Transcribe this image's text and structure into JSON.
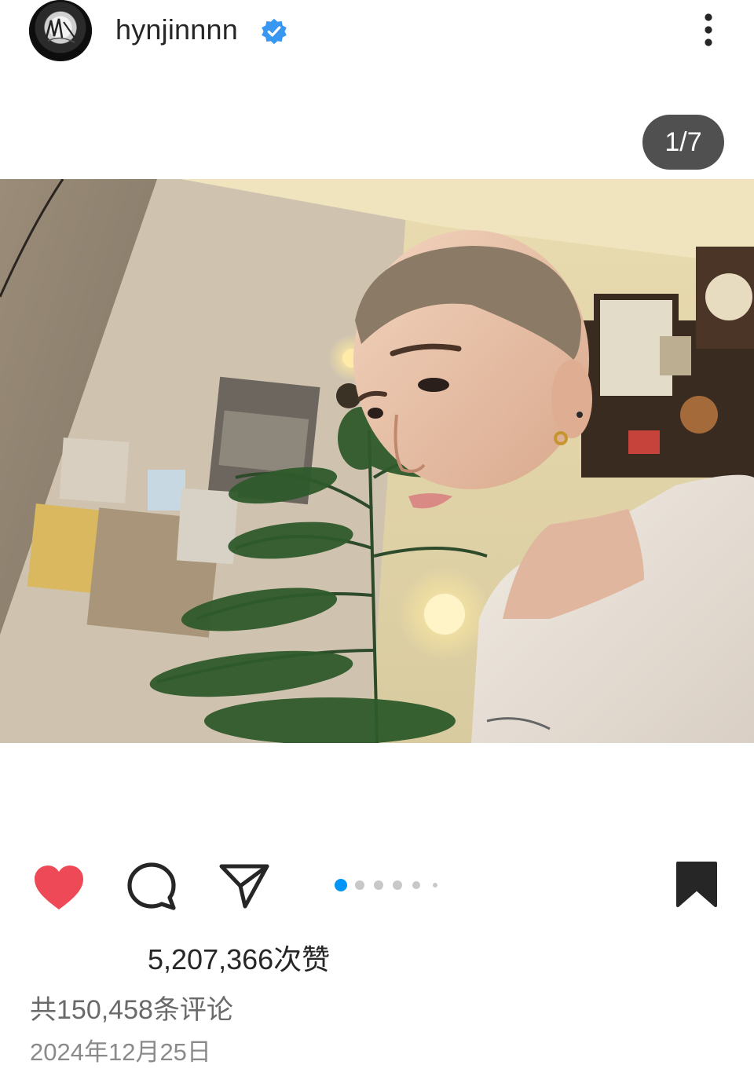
{
  "header": {
    "username": "hynjinnnn",
    "verified": true,
    "avatar_icon": "avatar-image",
    "more_icon": "more-vertical-icon",
    "verified_color": "#3897f0"
  },
  "post": {
    "counter": "1/7",
    "image_description_icon": "photo",
    "carousel": {
      "total_dots_visible": 6,
      "active_index": 0,
      "active_color": "#0095f6",
      "inactive_color": "#c8c8c8"
    }
  },
  "actions": {
    "like_icon": "heart-filled-icon",
    "like_color": "#ed4956",
    "comment_icon": "comment-icon",
    "share_icon": "paper-plane-icon",
    "save_icon": "bookmark-filled-icon"
  },
  "stats": {
    "likes_text": "5,207,366次赞",
    "comments_text": "共150,458条评论",
    "date_text": "2024年12月25日"
  }
}
